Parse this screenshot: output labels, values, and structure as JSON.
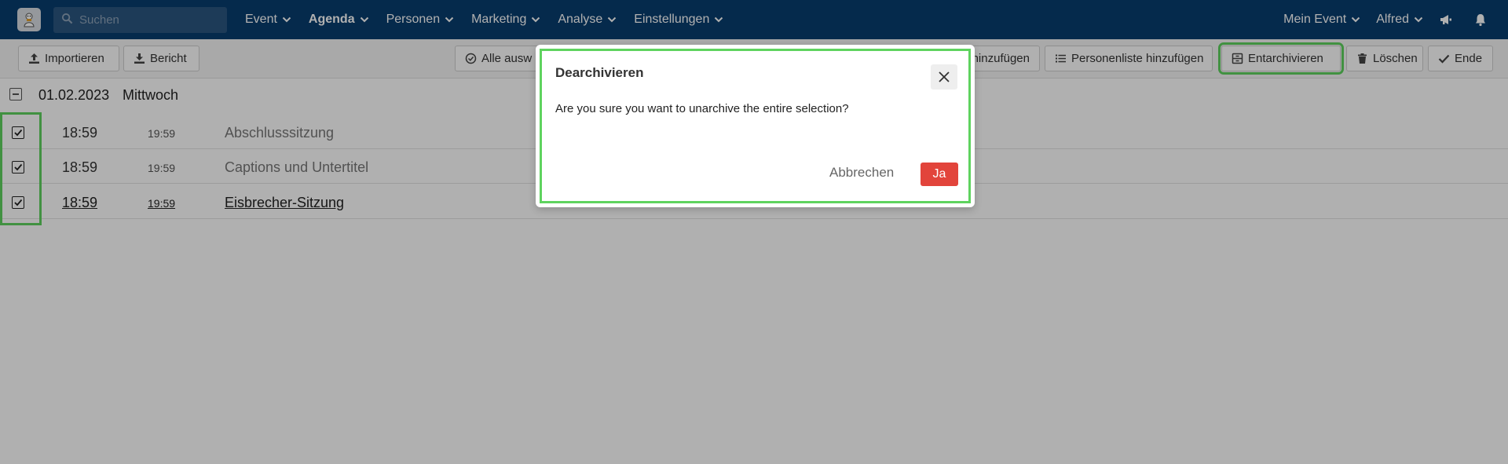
{
  "nav": {
    "search_placeholder": "Suchen",
    "menu": [
      "Event",
      "Agenda",
      "Personen",
      "Marketing",
      "Analyse",
      "Einstellungen"
    ],
    "active": "Agenda",
    "event": "Mein Event",
    "user": "Alfred"
  },
  "toolbar": {
    "import": "Importieren",
    "report": "Bericht",
    "select_all": "Alle ausw",
    "add_partial": "hinzufügen",
    "add_person_list": "Personenliste hinzufügen",
    "unarchive": "Entarchivieren",
    "delete": "Löschen",
    "done": "Ende"
  },
  "agenda": {
    "date": "01.02.2023",
    "weekday": "Mittwoch",
    "sessions": [
      {
        "start": "18:59",
        "end": "19:59",
        "title": "Abschlusssitzung",
        "checked": true
      },
      {
        "start": "18:59",
        "end": "19:59",
        "title": "Captions und Untertitel",
        "checked": true
      },
      {
        "start": "18:59",
        "end": "19:59",
        "title": "Eisbrecher-Sitzung",
        "checked": true
      }
    ]
  },
  "modal": {
    "title": "Dearchivieren",
    "message": "Are you sure you want to unarchive the entire selection?",
    "cancel": "Abbrechen",
    "confirm": "Ja"
  },
  "colors": {
    "nav_bg": "#083d6e",
    "highlight": "#5fd35f",
    "confirm": "#e2443b"
  }
}
